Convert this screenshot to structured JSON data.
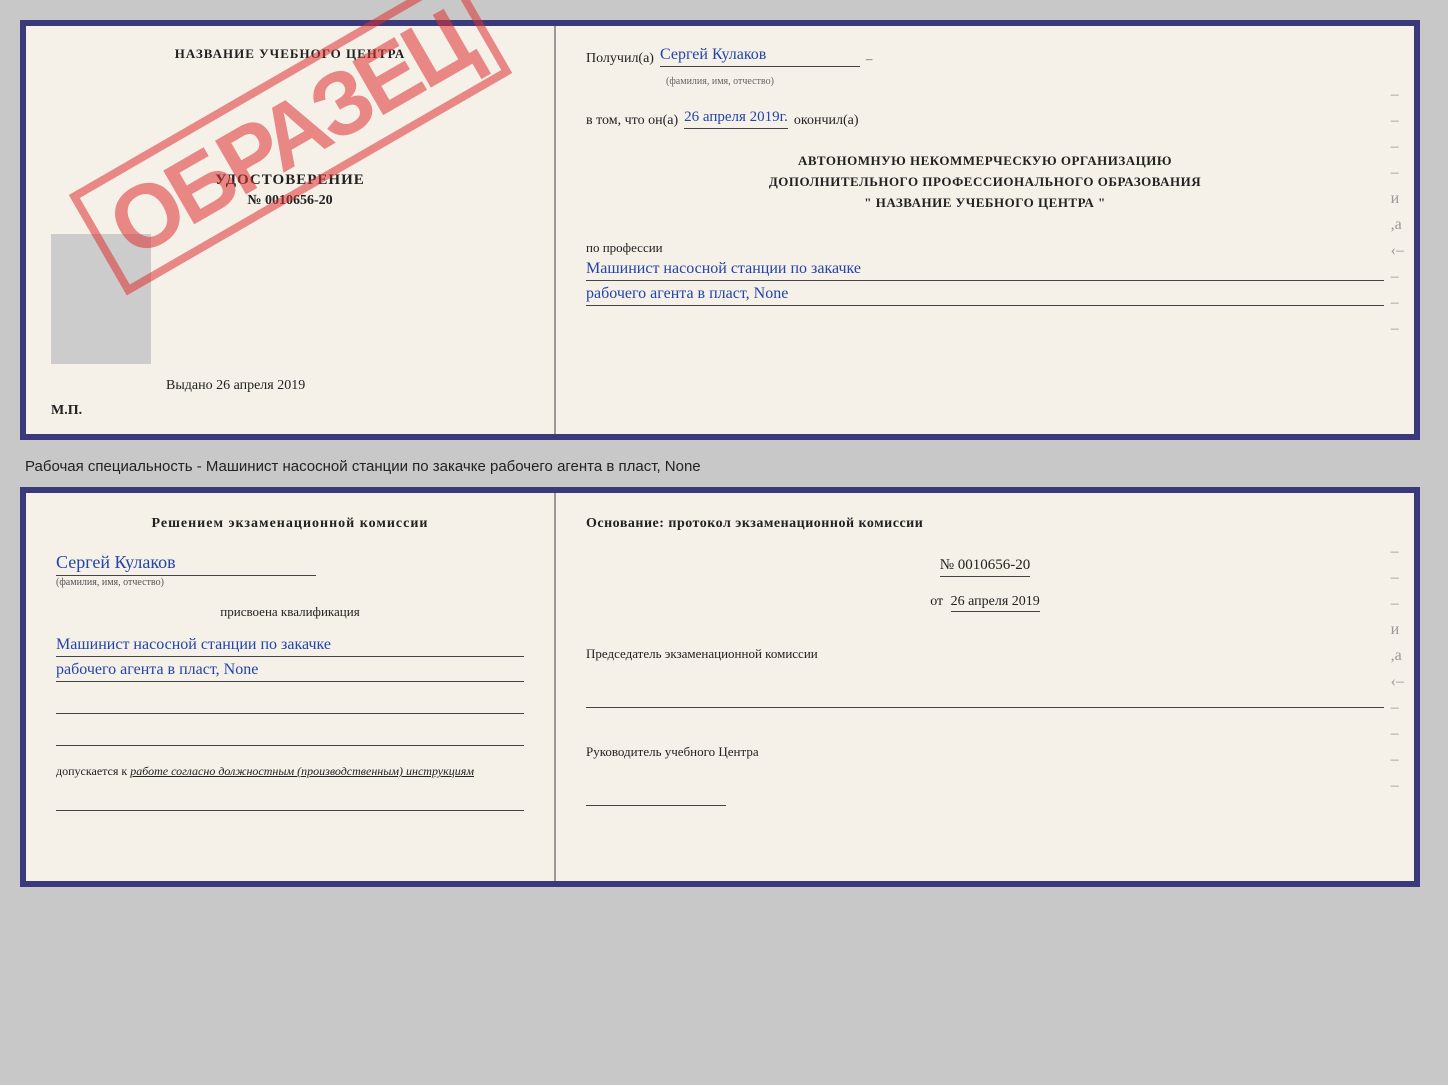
{
  "topDoc": {
    "left": {
      "centerTitle": "НАЗВАНИЕ УЧЕБНОГО ЦЕНТРА",
      "stampText": "ОБРАЗЕЦ",
      "udostoverenie": "УДОСТОВЕРЕНИЕ",
      "number": "№ 0010656-20",
      "vydano": "Выдано 26 апреля 2019",
      "mp": "М.П."
    },
    "right": {
      "poluchilLabel": "Получил(а)",
      "poluchilValue": "Сергей Кулаков",
      "familiyaHint": "(фамилия, имя, отчество)",
      "vTomChto": "в том, что он(а)",
      "date": "26 апреля 2019г.",
      "okonchil": "окончил(а)",
      "blockText1": "АВТОНОМНУЮ НЕКОММЕРЧЕСКУЮ ОРГАНИЗАЦИЮ",
      "blockText2": "ДОПОЛНИТЕЛЬНОГО ПРОФЕССИОНАЛЬНОГО ОБРАЗОВАНИЯ",
      "blockText3": "\"  НАЗВАНИЕ УЧЕБНОГО ЦЕНТРА  \"",
      "poProfilessii": "по профессии",
      "profession1": "Машинист насосной станции по закачке",
      "profession2": "рабочего агента в пласт, None"
    }
  },
  "betweenText": "Рабочая специальность - Машинист насосной станции по закачке рабочего агента в пласт, None",
  "bottomDoc": {
    "left": {
      "resheniem": "Решением экзаменационной комиссии",
      "nameValue": "Сергей Кулаков",
      "familiyaHint": "(фамилия, имя, отчество)",
      "prisvoena": "присвоена квалификация",
      "kval1": "Машинист насосной станции по закачке",
      "kval2": "рабочего агента в пласт, None",
      "dopuskaetsya": "допускается к",
      "dopWork": "работе согласно должностным (производственным) инструкциям"
    },
    "right": {
      "osnovanie": "Основание: протокол экзаменационной комиссии",
      "number": "№ 0010656-20",
      "dateLabel": "от",
      "dateValue": "26 апреля 2019",
      "predsedatel": "Председатель экзаменационной комиссии",
      "rukovoditel": "Руководитель учебного Центра"
    }
  },
  "dashes": [
    "-",
    "-",
    "-",
    "-",
    "и",
    ",а",
    "‹-",
    "-",
    "-",
    "-"
  ]
}
